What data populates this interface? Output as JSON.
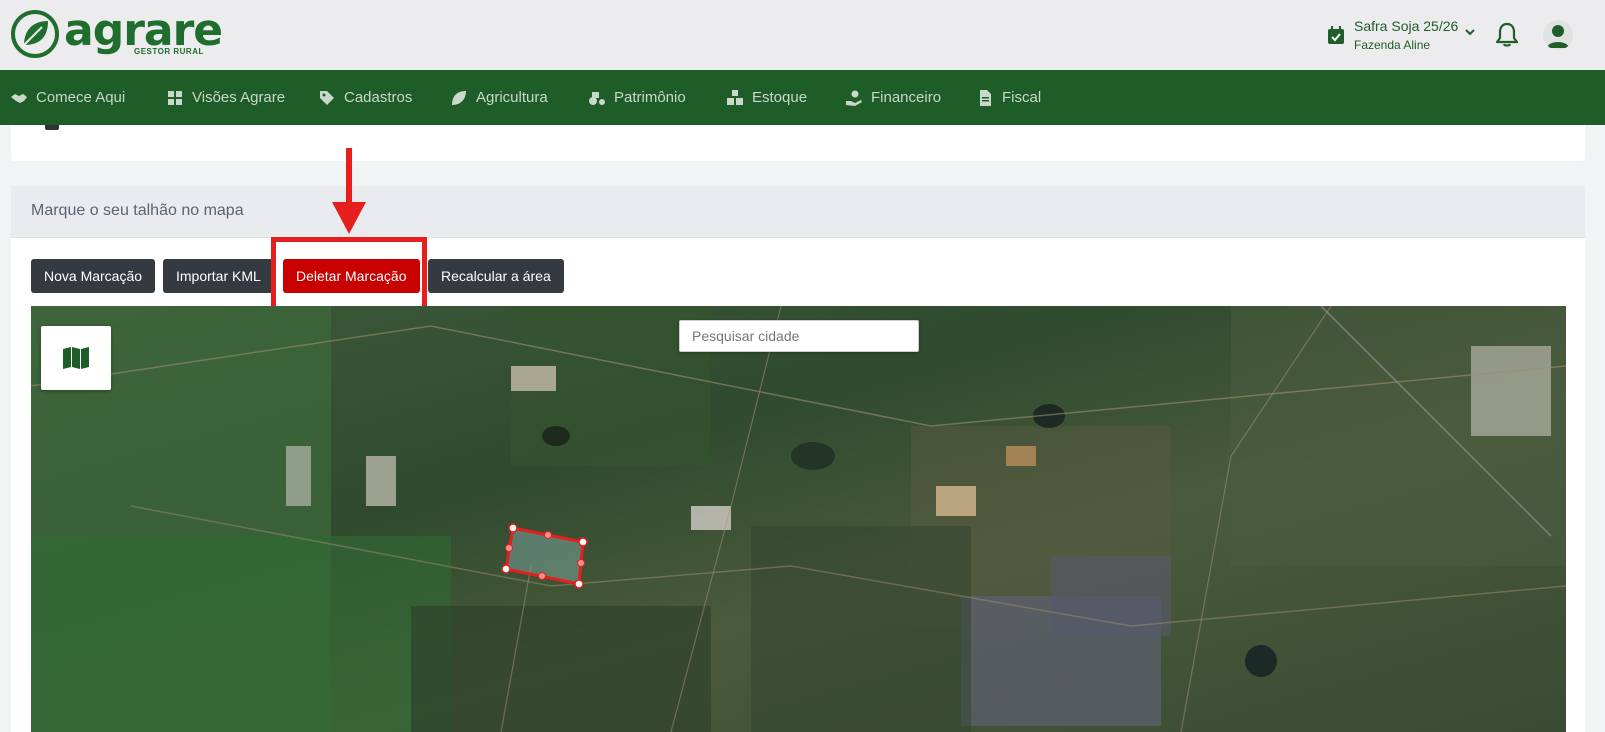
{
  "brand": {
    "name": "agrare",
    "tagline": "GESTOR RURAL"
  },
  "header": {
    "season_title": "Safra Soja 25/26",
    "farm_name": "Fazenda Aline"
  },
  "nav": {
    "items": [
      {
        "label": "Comece Aqui",
        "icon": "handshake-icon"
      },
      {
        "label": "Visões Agrare",
        "icon": "dashboard-icon"
      },
      {
        "label": "Cadastros",
        "icon": "tags-icon"
      },
      {
        "label": "Agricultura",
        "icon": "leaf-icon"
      },
      {
        "label": "Patrimônio",
        "icon": "tractor-icon"
      },
      {
        "label": "Estoque",
        "icon": "boxes-icon"
      },
      {
        "label": "Financeiro",
        "icon": "money-hand-icon"
      },
      {
        "label": "Fiscal",
        "icon": "document-icon"
      }
    ]
  },
  "map_section": {
    "title": "Marque o seu talhão no mapa",
    "buttons": {
      "new": "Nova Marcação",
      "import": "Importar KML",
      "delete": "Deletar Marcação",
      "recalc": "Recalcular a área"
    },
    "search_placeholder": "Pesquisar cidade"
  },
  "colors": {
    "brand_green": "#1f6e2e",
    "nav_green": "#1e5c28",
    "danger": "#c80000",
    "annotation_red": "#e51e1e",
    "dark_button": "#343a40"
  }
}
